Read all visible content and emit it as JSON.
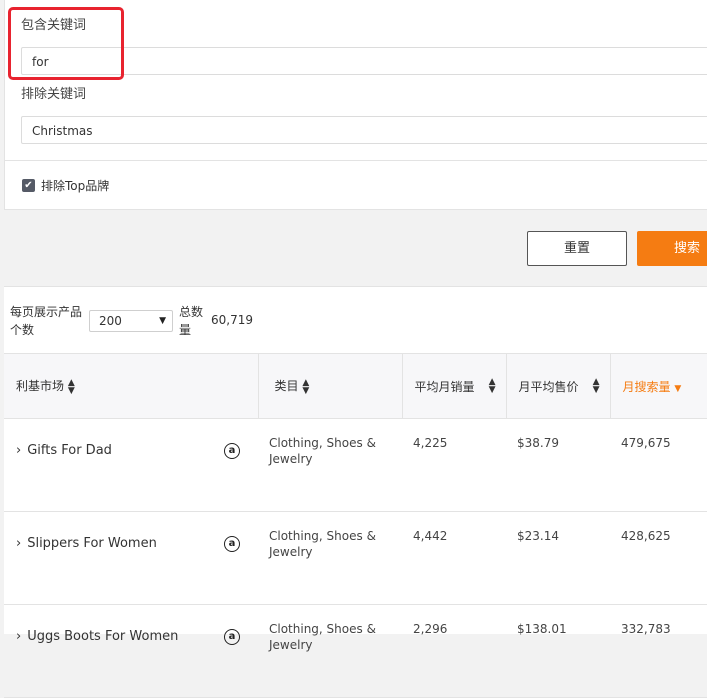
{
  "filters": {
    "include_label": "包含关键词",
    "include_value": "for",
    "exclude_label": "排除关键词",
    "exclude_value": "Christmas",
    "exclude_top_label": "排除Top品牌",
    "exclude_top_checked": true
  },
  "buttons": {
    "reset": "重置",
    "search": "搜索"
  },
  "results": {
    "per_page_label": "每页展示产品个数",
    "per_page_value": "200",
    "total_label": "总数量",
    "total_value": "60,719"
  },
  "columns": [
    "利基市场",
    "类目",
    "平均月销量",
    "月平均售价",
    "月搜索量"
  ],
  "rows": [
    {
      "market": "Gifts For Dad",
      "category": "Clothing, Shoes & Jewelry",
      "sales": "4,225",
      "price": "$38.79",
      "searches": "479,675"
    },
    {
      "market": "Slippers For Women",
      "category": "Clothing, Shoes & Jewelry",
      "sales": "4,442",
      "price": "$23.14",
      "searches": "428,625"
    },
    {
      "market": "Uggs Boots For Women",
      "category": "Clothing, Shoes & Jewelry",
      "sales": "2,296",
      "price": "$138.01",
      "searches": "332,783"
    }
  ],
  "icons": {
    "market_expand": "chevron-right-icon",
    "marketplace": "amazon-icon",
    "sort": "sort-icon"
  },
  "colors": {
    "accent": "#f57c12",
    "highlight": "#e8232f"
  }
}
